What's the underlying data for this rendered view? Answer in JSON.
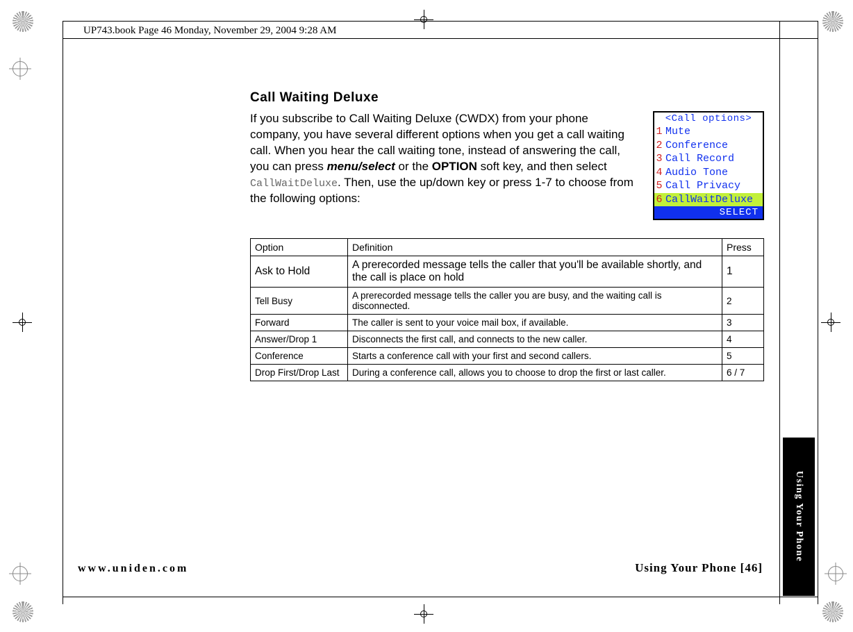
{
  "doc_header": "UP743.book  Page 46  Monday, November 29, 2004  9:28 AM",
  "section_title": "Call Waiting Deluxe",
  "intro": {
    "p1a": "If you subscribe to Call Waiting Deluxe (CWDX) from your phone company, you have several different options when you get a call waiting call. When you hear the call waiting tone, instead of answering the call, you can press ",
    "menuselect": "menu/select",
    "p1b": " or the ",
    "optionkey": "OPTION",
    "p1c": " soft key, and then select ",
    "monolabel": "CallWaitDeluxe",
    "p1d": ". Then, use the up/down key or press 1-7 to choose from the following options:"
  },
  "phone": {
    "title": "<Call options>",
    "items": [
      {
        "num": "1",
        "label": "Mute"
      },
      {
        "num": "2",
        "label": "Conference"
      },
      {
        "num": "3",
        "label": "Call Record"
      },
      {
        "num": "4",
        "label": "Audio Tone"
      },
      {
        "num": "5",
        "label": "Call Privacy"
      },
      {
        "num": "6",
        "label": "CallWaitDeluxe"
      }
    ],
    "softkey": "SELECT"
  },
  "table": {
    "headers": {
      "option": "Option",
      "definition": " Definition",
      "press": "Press"
    },
    "rows": [
      {
        "option": "Ask to Hold",
        "definition": "A prerecorded message tells the caller that you'll be available shortly, and the call is place on hold",
        "press": "1",
        "cls": "row-big"
      },
      {
        "option": "Tell Busy",
        "definition": " A prerecorded message tells the caller you are busy, and the waiting call is disconnected.",
        "press": "2",
        "cls": "row-small"
      },
      {
        "option": "Forward",
        "definition": "The caller is sent to your voice mail box, if available.",
        "press": "3",
        "cls": "row-small"
      },
      {
        "option": "Answer/Drop 1",
        "definition": " Disconnects the first call, and connects to the new caller.",
        "press": "4",
        "cls": "row-small"
      },
      {
        "option": "Conference",
        "definition": "Starts a conference call with your first and second callers.",
        "press": "5",
        "cls": "row-small"
      },
      {
        "option": "Drop First/Drop Last",
        "definition": "During a conference call, allows you to choose to drop the first or last caller.",
        "press": "6 / 7",
        "cls": "row-small"
      }
    ]
  },
  "footer": {
    "left": "www.uniden.com",
    "right": "Using Your Phone [46]",
    "sidetab": "Using Your Phone"
  }
}
